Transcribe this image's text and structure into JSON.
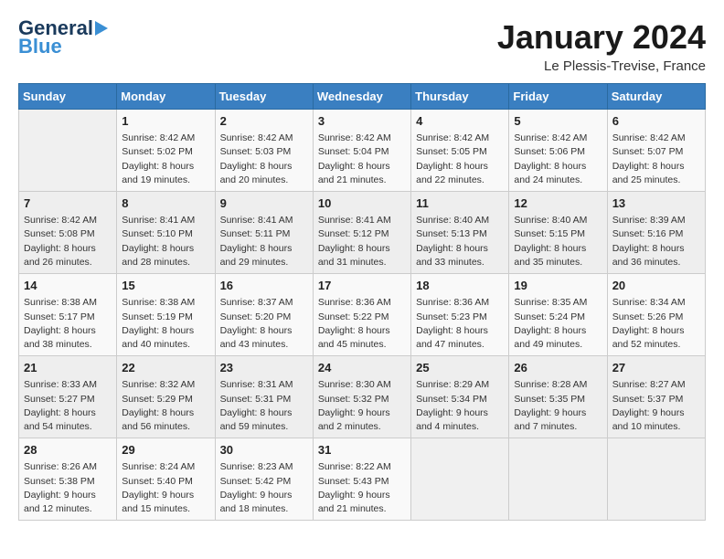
{
  "logo": {
    "text1": "General",
    "text2": "Blue"
  },
  "title": "January 2024",
  "location": "Le Plessis-Trevise, France",
  "days_header": [
    "Sunday",
    "Monday",
    "Tuesday",
    "Wednesday",
    "Thursday",
    "Friday",
    "Saturday"
  ],
  "weeks": [
    [
      {
        "day": "",
        "info": ""
      },
      {
        "day": "1",
        "info": "Sunrise: 8:42 AM\nSunset: 5:02 PM\nDaylight: 8 hours\nand 19 minutes."
      },
      {
        "day": "2",
        "info": "Sunrise: 8:42 AM\nSunset: 5:03 PM\nDaylight: 8 hours\nand 20 minutes."
      },
      {
        "day": "3",
        "info": "Sunrise: 8:42 AM\nSunset: 5:04 PM\nDaylight: 8 hours\nand 21 minutes."
      },
      {
        "day": "4",
        "info": "Sunrise: 8:42 AM\nSunset: 5:05 PM\nDaylight: 8 hours\nand 22 minutes."
      },
      {
        "day": "5",
        "info": "Sunrise: 8:42 AM\nSunset: 5:06 PM\nDaylight: 8 hours\nand 24 minutes."
      },
      {
        "day": "6",
        "info": "Sunrise: 8:42 AM\nSunset: 5:07 PM\nDaylight: 8 hours\nand 25 minutes."
      }
    ],
    [
      {
        "day": "7",
        "info": "Sunrise: 8:42 AM\nSunset: 5:08 PM\nDaylight: 8 hours\nand 26 minutes."
      },
      {
        "day": "8",
        "info": "Sunrise: 8:41 AM\nSunset: 5:10 PM\nDaylight: 8 hours\nand 28 minutes."
      },
      {
        "day": "9",
        "info": "Sunrise: 8:41 AM\nSunset: 5:11 PM\nDaylight: 8 hours\nand 29 minutes."
      },
      {
        "day": "10",
        "info": "Sunrise: 8:41 AM\nSunset: 5:12 PM\nDaylight: 8 hours\nand 31 minutes."
      },
      {
        "day": "11",
        "info": "Sunrise: 8:40 AM\nSunset: 5:13 PM\nDaylight: 8 hours\nand 33 minutes."
      },
      {
        "day": "12",
        "info": "Sunrise: 8:40 AM\nSunset: 5:15 PM\nDaylight: 8 hours\nand 35 minutes."
      },
      {
        "day": "13",
        "info": "Sunrise: 8:39 AM\nSunset: 5:16 PM\nDaylight: 8 hours\nand 36 minutes."
      }
    ],
    [
      {
        "day": "14",
        "info": "Sunrise: 8:38 AM\nSunset: 5:17 PM\nDaylight: 8 hours\nand 38 minutes."
      },
      {
        "day": "15",
        "info": "Sunrise: 8:38 AM\nSunset: 5:19 PM\nDaylight: 8 hours\nand 40 minutes."
      },
      {
        "day": "16",
        "info": "Sunrise: 8:37 AM\nSunset: 5:20 PM\nDaylight: 8 hours\nand 43 minutes."
      },
      {
        "day": "17",
        "info": "Sunrise: 8:36 AM\nSunset: 5:22 PM\nDaylight: 8 hours\nand 45 minutes."
      },
      {
        "day": "18",
        "info": "Sunrise: 8:36 AM\nSunset: 5:23 PM\nDaylight: 8 hours\nand 47 minutes."
      },
      {
        "day": "19",
        "info": "Sunrise: 8:35 AM\nSunset: 5:24 PM\nDaylight: 8 hours\nand 49 minutes."
      },
      {
        "day": "20",
        "info": "Sunrise: 8:34 AM\nSunset: 5:26 PM\nDaylight: 8 hours\nand 52 minutes."
      }
    ],
    [
      {
        "day": "21",
        "info": "Sunrise: 8:33 AM\nSunset: 5:27 PM\nDaylight: 8 hours\nand 54 minutes."
      },
      {
        "day": "22",
        "info": "Sunrise: 8:32 AM\nSunset: 5:29 PM\nDaylight: 8 hours\nand 56 minutes."
      },
      {
        "day": "23",
        "info": "Sunrise: 8:31 AM\nSunset: 5:31 PM\nDaylight: 8 hours\nand 59 minutes."
      },
      {
        "day": "24",
        "info": "Sunrise: 8:30 AM\nSunset: 5:32 PM\nDaylight: 9 hours\nand 2 minutes."
      },
      {
        "day": "25",
        "info": "Sunrise: 8:29 AM\nSunset: 5:34 PM\nDaylight: 9 hours\nand 4 minutes."
      },
      {
        "day": "26",
        "info": "Sunrise: 8:28 AM\nSunset: 5:35 PM\nDaylight: 9 hours\nand 7 minutes."
      },
      {
        "day": "27",
        "info": "Sunrise: 8:27 AM\nSunset: 5:37 PM\nDaylight: 9 hours\nand 10 minutes."
      }
    ],
    [
      {
        "day": "28",
        "info": "Sunrise: 8:26 AM\nSunset: 5:38 PM\nDaylight: 9 hours\nand 12 minutes."
      },
      {
        "day": "29",
        "info": "Sunrise: 8:24 AM\nSunset: 5:40 PM\nDaylight: 9 hours\nand 15 minutes."
      },
      {
        "day": "30",
        "info": "Sunrise: 8:23 AM\nSunset: 5:42 PM\nDaylight: 9 hours\nand 18 minutes."
      },
      {
        "day": "31",
        "info": "Sunrise: 8:22 AM\nSunset: 5:43 PM\nDaylight: 9 hours\nand 21 minutes."
      },
      {
        "day": "",
        "info": ""
      },
      {
        "day": "",
        "info": ""
      },
      {
        "day": "",
        "info": ""
      }
    ]
  ]
}
